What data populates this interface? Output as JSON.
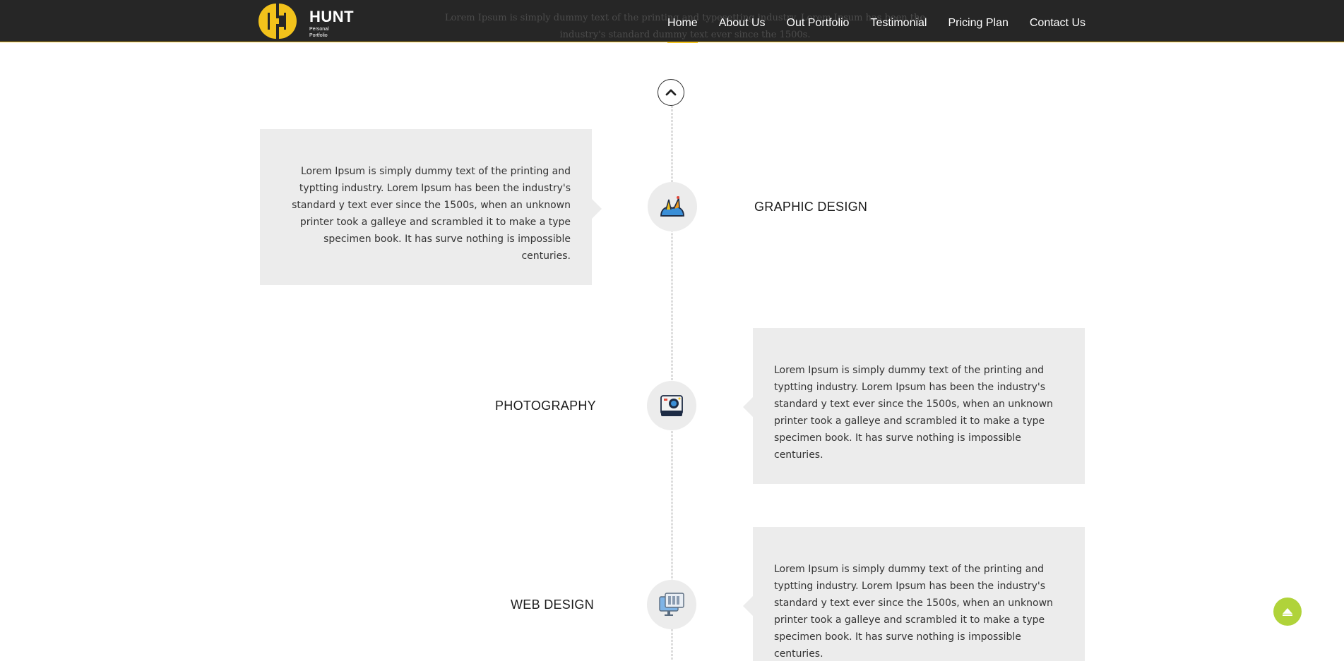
{
  "brand": {
    "name": "HUNT",
    "tagline": "Personal Portfolio",
    "accent_color": "#f2c21b",
    "header_bg": "#262626"
  },
  "behind_text": "Lorem Ipsum is simply dummy text of the printing and typesetting industry. Lorem Ipsum has been the industry's standard dummy text ever since the 1500s.",
  "nav": {
    "items": [
      {
        "label": "Home",
        "active": true
      },
      {
        "label": "About Us",
        "active": false
      },
      {
        "label": "Out Portfolio",
        "active": false
      },
      {
        "label": "Testimonial",
        "active": false
      },
      {
        "label": "Pricing Plan",
        "active": false
      },
      {
        "label": "Contact Us",
        "active": false
      }
    ]
  },
  "timeline": {
    "top_icon": "chevron-up-icon",
    "items": [
      {
        "title": "GRAPHIC DESIGN",
        "icon": "graphic-design-icon",
        "text": "Lorem Ipsum is simply dummy text of the printing and typtting industry. Lorem Ipsum has been the industry's standard y text ever since the 1500s, when an unknown printer took a galleye and scrambled it to make a type specimen book. It has surve nothing is impossible centuries."
      },
      {
        "title": "PHOTOGRAPHY",
        "icon": "camera-icon",
        "text": "Lorem Ipsum is simply dummy text of the printing and typtting industry. Lorem Ipsum has been the industry's standard y text ever since the 1500s, when an unknown printer took a galleye and scrambled it to make a type specimen book. It has surve nothing is impossible centuries."
      },
      {
        "title": "WEB DESIGN",
        "icon": "web-design-icon",
        "text": "Lorem Ipsum is simply dummy text of the printing and typtting industry. Lorem Ipsum has been the industry's standard y text ever since the 1500s, when an unknown printer took a galleye and scrambled it to make a type specimen book. It has surve nothing is impossible centuries."
      }
    ]
  },
  "scroll_top": {
    "icon": "scroll-to-top-icon",
    "color": "#b0d33a"
  }
}
